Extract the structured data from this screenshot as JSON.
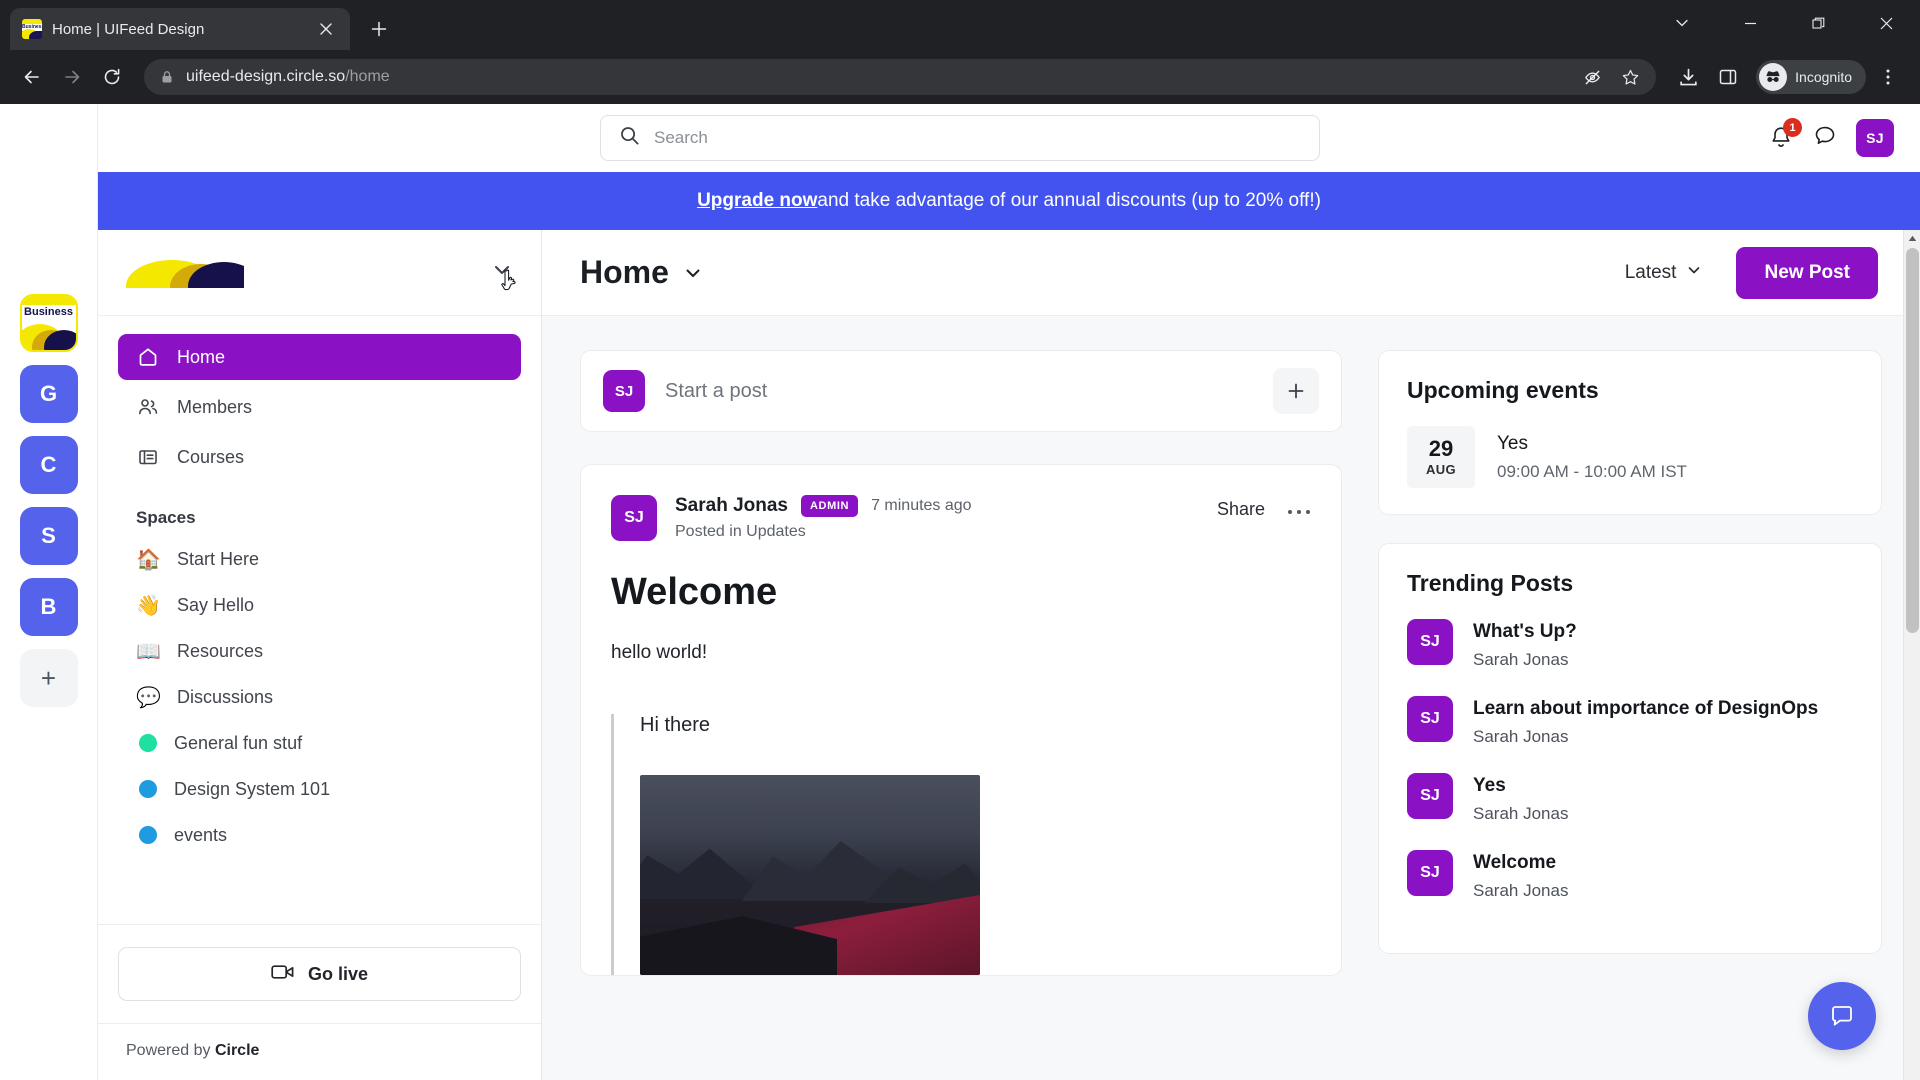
{
  "browser": {
    "tab": {
      "title": "Home | UIFeed Design",
      "close_icon": "close-icon",
      "favicon_label": "Business"
    },
    "new_tab_label": "+",
    "window": {
      "minimize": "—",
      "maximize": "❐",
      "close": "✕",
      "chevron": "⌄"
    },
    "nav": {
      "back": "←",
      "forward": "→",
      "reload": "⟳"
    },
    "url": {
      "domain": "uifeed-design.circle.so",
      "path": "/home"
    },
    "toolbar_icons": [
      "eye-off-icon",
      "star-icon",
      "download-icon",
      "side-panel-icon"
    ],
    "profile_chip": "Incognito",
    "menu_icon": "kebab-menu-icon"
  },
  "app_header": {
    "grid_icon": "apps-grid-icon",
    "search_placeholder": "Search",
    "notification_count": "1",
    "messages_icon": "chat-bubble-icon",
    "avatar_initials": "SJ"
  },
  "banner": {
    "link_text": "Upgrade now",
    "rest_text": " and take advantage of our annual discounts (up to 20% off!)"
  },
  "rail": {
    "items": [
      {
        "name": "workspace-business",
        "label": "Business",
        "type": "logo"
      },
      {
        "name": "workspace-g",
        "label": "G",
        "type": "letter"
      },
      {
        "name": "workspace-c",
        "label": "C",
        "type": "letter"
      },
      {
        "name": "workspace-s",
        "label": "S",
        "type": "letter"
      },
      {
        "name": "workspace-b",
        "label": "B",
        "type": "letter"
      },
      {
        "name": "workspace-add",
        "label": "+",
        "type": "add"
      }
    ]
  },
  "sidebar": {
    "chevron": "⌄",
    "nav": [
      {
        "label": "Home",
        "icon": "home-icon",
        "active": true
      },
      {
        "label": "Members",
        "icon": "members-icon",
        "active": false
      },
      {
        "label": "Courses",
        "icon": "courses-icon",
        "active": false
      }
    ],
    "spaces_heading": "Spaces",
    "spaces": [
      {
        "label": "Start Here",
        "emoji": "🏠",
        "type": "emoji"
      },
      {
        "label": "Say Hello",
        "emoji": "👋",
        "type": "emoji"
      },
      {
        "label": "Resources",
        "emoji": "📖",
        "type": "emoji"
      },
      {
        "label": "Discussions",
        "emoji": "💬",
        "type": "emoji"
      },
      {
        "label": "General fun stuf",
        "color": "#1fe0a0",
        "type": "dot"
      },
      {
        "label": "Design System 101",
        "color": "#1f9ce0",
        "type": "dot"
      },
      {
        "label": "events",
        "color": "#1f9ce0",
        "type": "dot"
      }
    ],
    "go_live": {
      "label": "Go live",
      "icon": "video-camera-icon"
    },
    "footer": {
      "prefix": "Powered by ",
      "brand": "Circle"
    }
  },
  "main": {
    "title": "Home",
    "title_chevron": "⌄",
    "sort": {
      "label": "Latest",
      "chevron": "⌄"
    },
    "new_post_label": "New Post",
    "composer": {
      "avatar": "SJ",
      "placeholder": "Start a post",
      "add_icon": "plus-icon"
    },
    "post": {
      "avatar": "SJ",
      "author": "Sarah Jonas",
      "badge": "ADMIN",
      "time": "7 minutes ago",
      "posted_in": "Posted in Updates",
      "share_label": "Share",
      "more_icon": "more-horizontal-icon",
      "title": "Welcome",
      "body": "hello world!",
      "quote": "Hi there",
      "image_alt": "mountain-landscape-image"
    }
  },
  "right": {
    "events": {
      "title": "Upcoming events",
      "items": [
        {
          "day": "29",
          "month": "AUG",
          "name": "Yes",
          "time": "09:00 AM - 10:00 AM IST"
        }
      ]
    },
    "trending": {
      "title": "Trending Posts",
      "items": [
        {
          "avatar": "SJ",
          "title": "What's Up?",
          "author": "Sarah Jonas"
        },
        {
          "avatar": "SJ",
          "title": "Learn about importance of DesignOps",
          "author": "Sarah Jonas"
        },
        {
          "avatar": "SJ",
          "title": "Yes",
          "author": "Sarah Jonas"
        },
        {
          "avatar": "SJ",
          "title": "Welcome",
          "author": "Sarah Jonas"
        }
      ]
    },
    "chat_fab_icon": "chat-bubble-icon"
  },
  "colors": {
    "brand_purple": "#8b12c4",
    "banner_blue": "#4353ef",
    "rail_blue": "#5562eb",
    "badge_red": "#d92d20"
  }
}
